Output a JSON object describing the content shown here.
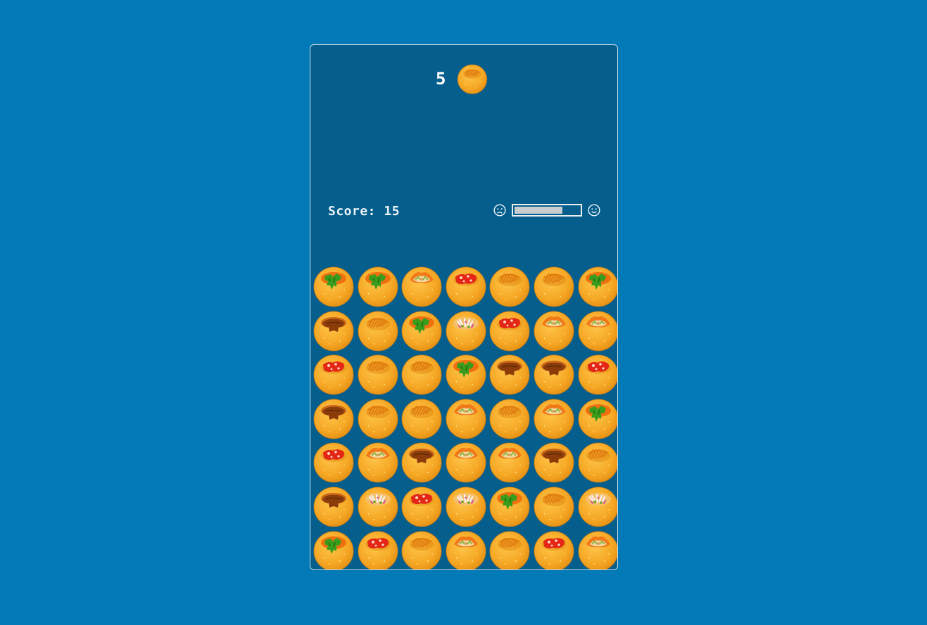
{
  "order": {
    "count": "5",
    "puri_type": "sev"
  },
  "score": {
    "text": "Score: 15"
  },
  "mood": {
    "left_icon": "sad-face-icon",
    "right_icon": "happy-face-icon",
    "level": 0.74
  },
  "colors": {
    "background": "#017ab7",
    "panel": "#055e8c",
    "puri": "#f5a623",
    "puri_dark": "#e08a10",
    "sev": "#e07a10",
    "mint": "#3a9c1c",
    "tamarind": "#8a3c0a",
    "chili": "#e32616",
    "masala": "#f3d8a0",
    "onion": "#f7f0f5"
  },
  "board": {
    "rows": 7,
    "cols": 7,
    "cells": [
      [
        "mint",
        "mint",
        "masala",
        "chili",
        "sev",
        "sev",
        "mint"
      ],
      [
        "tamarind",
        "sev",
        "mint",
        "onion",
        "chili",
        "masala",
        "masala"
      ],
      [
        "chili",
        "sev",
        "sev",
        "mint",
        "tamarind",
        "tamarind",
        "chili"
      ],
      [
        "tamarind",
        "sev",
        "sev",
        "masala",
        "sev",
        "masala",
        "mint"
      ],
      [
        "chili",
        "masala",
        "tamarind",
        "masala",
        "masala",
        "tamarind",
        "sev"
      ],
      [
        "tamarind",
        "onion",
        "chili",
        "onion",
        "mint",
        "sev",
        "onion"
      ],
      [
        "mint",
        "chili",
        "sev",
        "masala",
        "sev",
        "chili",
        "masala"
      ]
    ]
  }
}
